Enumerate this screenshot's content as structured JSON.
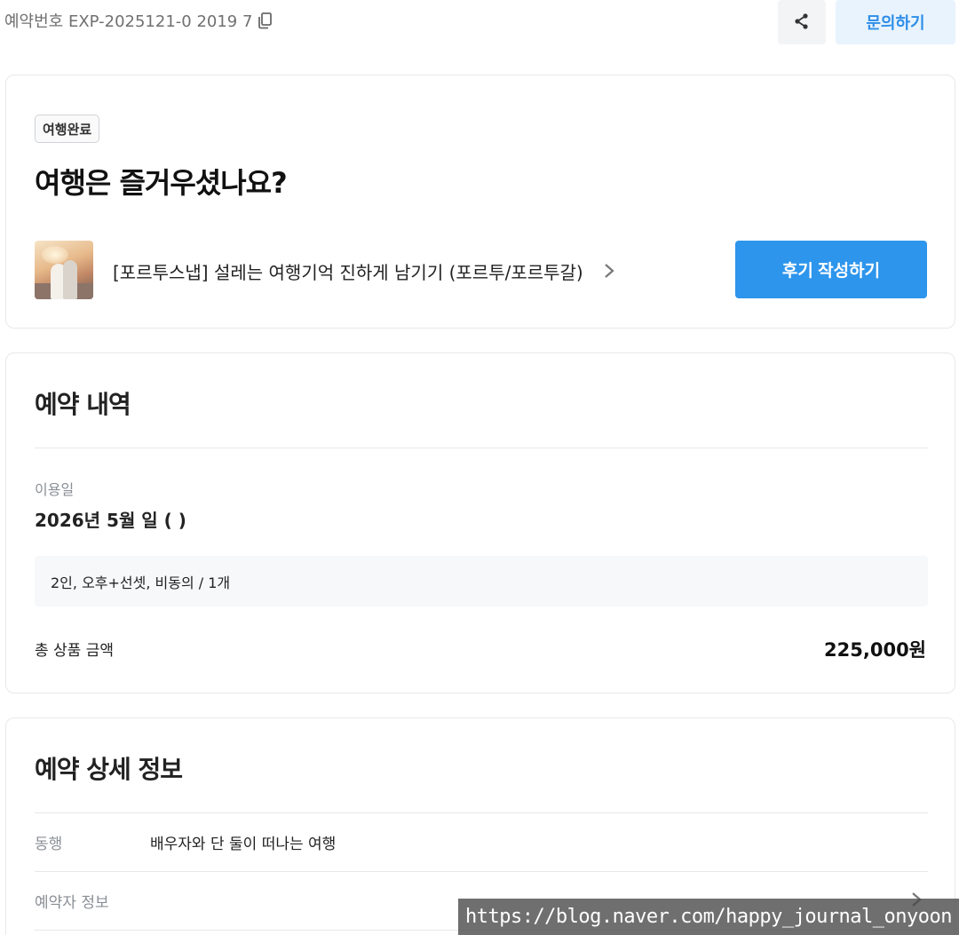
{
  "topbar": {
    "booking_number": "예약번호 EXP-2025121-0 2019 7",
    "inquiry_label": "문의하기"
  },
  "trip_card": {
    "status_badge": "여행완료",
    "headline": "여행은 즐거우셨나요?",
    "product_title": "[포르투스냅] 설레는 여행기억 진하게 남기기 (포르투/포르투갈)",
    "review_button": "후기 작성하기"
  },
  "booking_summary": {
    "title": "예약 내역",
    "date_label": "이용일",
    "date_value": "2026년 5월 일 ( )",
    "option_text": "2인, 오후+선셋, 비동의 / 1개",
    "total_label": "총 상품 금액",
    "total_value": "225,000원"
  },
  "booking_detail": {
    "title": "예약 상세 정보",
    "rows": [
      {
        "label": "동행",
        "value": "배우자와 단 둘이 떠나는 여행"
      },
      {
        "label": "예약자 정보",
        "value": ""
      }
    ]
  },
  "watermark": "https://blog.naver.com/happy_journal_onyoon",
  "colors": {
    "accent": "#2d95ec",
    "inquiry_bg": "#e8f3fd",
    "border": "#e6e8eb",
    "muted_text": "#8a8f95"
  },
  "icons": {
    "copy": "copy-icon",
    "share": "share-icon",
    "chevron": "chevron-right-icon"
  }
}
